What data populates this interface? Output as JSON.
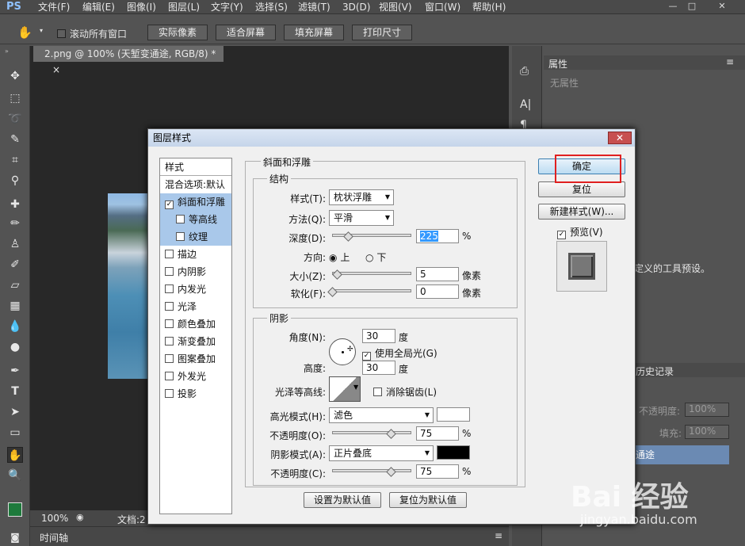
{
  "app": {
    "logo": "PS"
  },
  "menu": [
    "文件(F)",
    "编辑(E)",
    "图像(I)",
    "图层(L)",
    "文字(Y)",
    "选择(S)",
    "滤镜(T)",
    "3D(D)",
    "视图(V)",
    "窗口(W)",
    "帮助(H)"
  ],
  "window_controls": [
    "—",
    "□",
    "✕"
  ],
  "options": {
    "scroll_all": "滚动所有窗口",
    "buttons": [
      "实际像素",
      "适合屏幕",
      "填充屏幕",
      "打印尺寸"
    ]
  },
  "document": {
    "tab": "2.png @ 100% (天堑变通途, RGB/8) *",
    "tab_close": "×"
  },
  "status": {
    "zoom": "100%",
    "doc": "文档:2"
  },
  "timeline": {
    "label": "时间轴"
  },
  "panels": {
    "properties_tab": "属性",
    "no_properties": "无属性",
    "tool_desc": "定义的工具预设。",
    "history_tab": "历史记录",
    "opacity_label": "不透明度:",
    "opacity_value": "100%",
    "fill_label": "填充:",
    "fill_value": "100%",
    "layer_name": "通途"
  },
  "dialog": {
    "title": "图层样式",
    "close": "✕",
    "style_list": [
      {
        "label": "样式",
        "checkbox": false,
        "checked": false,
        "selected": false,
        "indent": false
      },
      {
        "label": "混合选项:默认",
        "checkbox": false,
        "checked": false,
        "selected": false,
        "indent": false
      },
      {
        "label": "斜面和浮雕",
        "checkbox": true,
        "checked": true,
        "selected": true,
        "indent": false
      },
      {
        "label": "等高线",
        "checkbox": true,
        "checked": false,
        "selected": true,
        "indent": true
      },
      {
        "label": "纹理",
        "checkbox": true,
        "checked": false,
        "selected": true,
        "indent": true
      },
      {
        "label": "描边",
        "checkbox": true,
        "checked": false,
        "selected": false,
        "indent": false
      },
      {
        "label": "内阴影",
        "checkbox": true,
        "checked": false,
        "selected": false,
        "indent": false
      },
      {
        "label": "内发光",
        "checkbox": true,
        "checked": false,
        "selected": false,
        "indent": false
      },
      {
        "label": "光泽",
        "checkbox": true,
        "checked": false,
        "selected": false,
        "indent": false
      },
      {
        "label": "颜色叠加",
        "checkbox": true,
        "checked": false,
        "selected": false,
        "indent": false
      },
      {
        "label": "渐变叠加",
        "checkbox": true,
        "checked": false,
        "selected": false,
        "indent": false
      },
      {
        "label": "图案叠加",
        "checkbox": true,
        "checked": false,
        "selected": false,
        "indent": false
      },
      {
        "label": "外发光",
        "checkbox": true,
        "checked": false,
        "selected": false,
        "indent": false
      },
      {
        "label": "投影",
        "checkbox": true,
        "checked": false,
        "selected": false,
        "indent": false
      }
    ],
    "section_title": "斜面和浮雕",
    "structure": {
      "title": "结构",
      "style_label": "样式(T):",
      "style_value": "枕状浮雕",
      "technique_label": "方法(Q):",
      "technique_value": "平滑",
      "depth_label": "深度(D):",
      "depth_value": "225",
      "depth_unit": "%",
      "direction_label": "方向:",
      "dir_up": "上",
      "dir_down": "下",
      "size_label": "大小(Z):",
      "size_value": "5",
      "size_unit": "像素",
      "soften_label": "软化(F):",
      "soften_value": "0",
      "soften_unit": "像素"
    },
    "shading": {
      "title": "阴影",
      "angle_label": "角度(N):",
      "angle_value": "30",
      "angle_unit": "度",
      "global_light": "使用全局光(G)",
      "altitude_label": "高度:",
      "altitude_value": "30",
      "altitude_unit": "度",
      "gloss_label": "光泽等高线:",
      "anti_alias": "消除锯齿(L)",
      "highlight_label": "高光模式(H):",
      "highlight_value": "滤色",
      "highlight_color": "#ffffff",
      "hl_opacity_label": "不透明度(O):",
      "hl_opacity_value": "75",
      "hl_opacity_unit": "%",
      "shadow_label": "阴影模式(A):",
      "shadow_value": "正片叠底",
      "shadow_color": "#000000",
      "sh_opacity_label": "不透明度(C):",
      "sh_opacity_value": "75",
      "sh_opacity_unit": "%"
    },
    "make_default": "设置为默认值",
    "reset_default": "复位为默认值",
    "ok": "确定",
    "reset": "复位",
    "new_style": "新建样式(W)...",
    "preview": "预览(V)"
  },
  "watermark": {
    "text": "Bai 经验",
    "url": "jingyan.baidu.com"
  },
  "colors": {
    "accent": "#e02020",
    "selection": "#a9c8ea",
    "foreground": "#1e7a3c"
  }
}
